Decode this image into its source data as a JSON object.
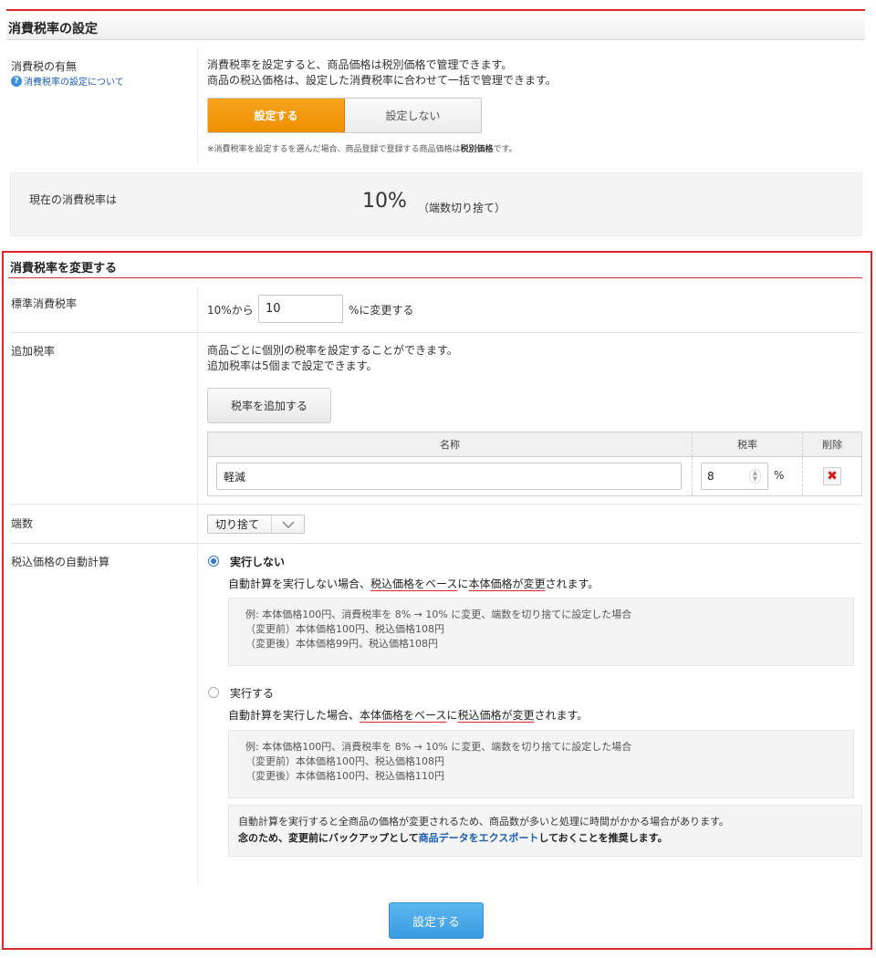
{
  "top": {
    "title": "消費税率の設定",
    "tax_presence_label": "消費税の有無",
    "help_link": "消費税率の設定について",
    "desc_line1": "消費税率を設定すると、商品価格は税別価格で管理できます。",
    "desc_line2": "商品の税込価格は、設定した消費税率に合わせて一括で管理できます。",
    "toggle_on": "設定する",
    "toggle_off": "設定しない",
    "toggle_selected": "設定する",
    "note_prefix": "※消費税率を設定するを選んだ場合、商品登録で登録する商品価格は",
    "note_bold": "税別価格",
    "note_suffix": "です。"
  },
  "current": {
    "label": "現在の消費税率は",
    "rate": "10%",
    "rounding": "（端数切り捨て）"
  },
  "change": {
    "title": "消費税率を変更する",
    "standard": {
      "label": "標準消費税率",
      "prefix": "10%から",
      "value": "10",
      "suffix": "%に変更する"
    },
    "additional": {
      "label": "追加税率",
      "desc_line1": "商品ごとに個別の税率を設定することができます。",
      "desc_line2": "追加税率は5個まで設定できます。",
      "add_button": "税率を追加する",
      "headers": {
        "name": "名称",
        "rate": "税率",
        "delete": "削除"
      },
      "rows": [
        {
          "name": "軽減",
          "rate": "8",
          "unit": "%"
        }
      ]
    },
    "rounding": {
      "label": "端数",
      "value": "切り捨て"
    },
    "auto_calc": {
      "label": "税込価格の自動計算",
      "option1": {
        "label": "実行しない",
        "selected": true,
        "desc_pre": "自動計算を実行しない場合、",
        "desc_u1": "税込価格をベース",
        "desc_mid": "に",
        "desc_u2": "本体価格が変更",
        "desc_post": "されます。",
        "ex_line1": "例: 本体価格100円、消費税率を 8% → 10% に変更、端数を切り捨てに設定した場合",
        "ex_line2": "（変更前）本体価格100円、税込価格108円",
        "ex_line3": "（変更後）本体価格99円、税込価格108円"
      },
      "option2": {
        "label": "実行する",
        "selected": false,
        "desc_pre": "自動計算を実行した場合、",
        "desc_u1": "本体価格をベース",
        "desc_mid": "に",
        "desc_u2": "税込価格が変更",
        "desc_post": "されます。",
        "ex_line1": "例: 本体価格100円、消費税率を 8% → 10% に変更、端数を切り捨てに設定した場合",
        "ex_line2": "（変更前）本体価格100円、税込価格108円",
        "ex_line3": "（変更後）本体価格100円、税込価格110円"
      },
      "warning_line1": "自動計算を実行すると全商品の価格が変更されるため、商品数が多いと処理に時間がかかる場合があります。",
      "warning_line2_pre": "念のため、変更前にバックアップとして",
      "warning_link": "商品データをエクスポート",
      "warning_line2_post": "しておくことを推奨します。"
    },
    "submit": "設定する"
  },
  "colors": {
    "accent_red": "#e0252b",
    "toggle_orange": "#f39800",
    "submit_blue": "#4aa8e8",
    "link_blue": "#1b5fb8"
  }
}
